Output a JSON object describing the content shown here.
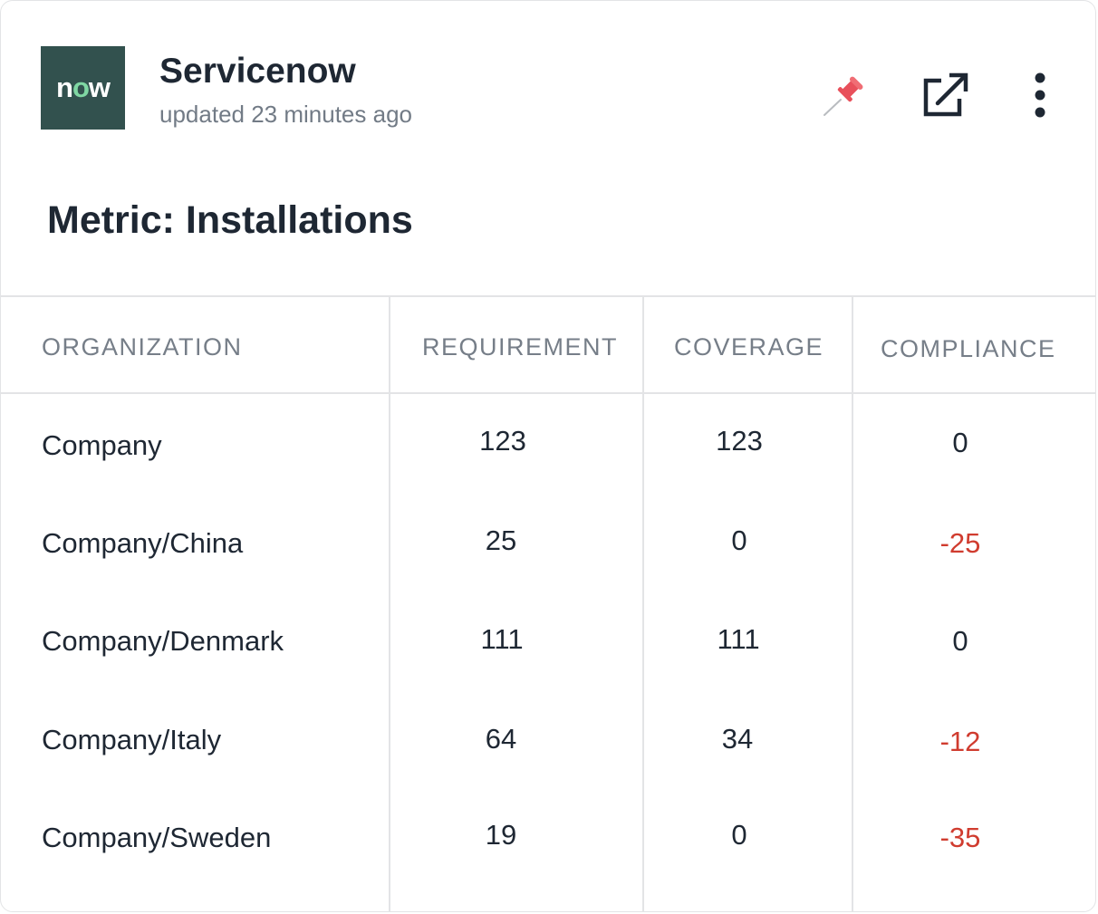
{
  "header": {
    "logo_text_pre": "n",
    "logo_text_o": "o",
    "logo_text_post": "w",
    "title": "Servicenow",
    "updated": "updated 23 minutes ago",
    "icons": [
      "pin-icon",
      "external-link-icon",
      "more-vertical-icon"
    ],
    "logo_bg_color": "#32514e",
    "pin_color": "#e8505b"
  },
  "metric_title": "Metric: Installations",
  "table": {
    "columns": [
      "ORGANIZATION",
      "REQUIREMENT",
      "COVERAGE",
      "COMPLIANCE"
    ],
    "rows": [
      {
        "organization": "Company",
        "requirement": "123",
        "coverage": "123",
        "compliance": "0"
      },
      {
        "organization": "Company/China",
        "requirement": "25",
        "coverage": "0",
        "compliance": "-25"
      },
      {
        "organization": "Company/Denmark",
        "requirement": "111",
        "coverage": "111",
        "compliance": "0"
      },
      {
        "organization": "Company/Italy",
        "requirement": "64",
        "coverage": "34",
        "compliance": "-12"
      },
      {
        "organization": "Company/Sweden",
        "requirement": "19",
        "coverage": "0",
        "compliance": "-35"
      }
    ],
    "negative_color": "#d03c2f"
  }
}
